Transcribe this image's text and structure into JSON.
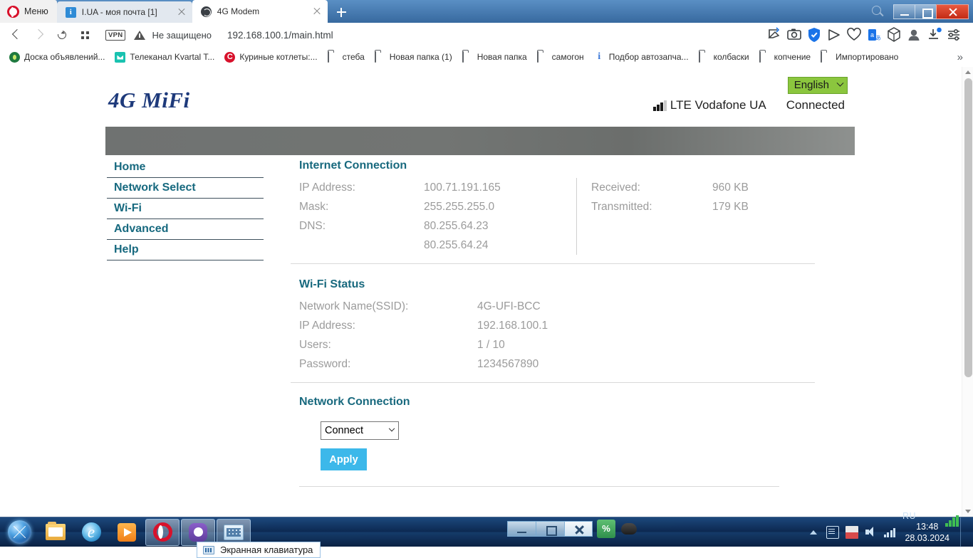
{
  "browser": {
    "opera_menu_label": "Меню",
    "tabs": [
      {
        "title": "I.UA - моя почта [1]",
        "favicon": "mail-icon",
        "active": false
      },
      {
        "title": "4G Modem",
        "favicon": "globe-icon",
        "active": true
      }
    ],
    "new_tab_label": "+",
    "window_controls": {
      "minimize": "minimize-icon",
      "maximize": "maximize-icon",
      "close": "close-icon"
    },
    "address_bar": {
      "vpn_badge": "VPN",
      "security_label": "Не защищено",
      "url": "192.168.100.1/main.html"
    },
    "toolbar_icons": [
      "snapshot-icon",
      "camera-icon",
      "shield-check-icon",
      "send-icon",
      "heart-icon",
      "translate-icon",
      "cube-icon",
      "profile-icon",
      "downloads-icon",
      "easy-setup-icon"
    ],
    "bookmarks": [
      {
        "label": "Доска объявлений...",
        "icon": "doska-icon"
      },
      {
        "label": "Телеканал Kvartal T...",
        "icon": "kvartal-icon"
      },
      {
        "label": "Куриные котлеты:...",
        "icon": "kotlety-icon"
      },
      {
        "label": "стеба",
        "icon": "folder-icon"
      },
      {
        "label": "Новая папка (1)",
        "icon": "folder-icon"
      },
      {
        "label": "Новая папка",
        "icon": "folder-icon"
      },
      {
        "label": "самогон",
        "icon": "folder-icon"
      },
      {
        "label": "Подбор автозапча...",
        "icon": "info-icon"
      },
      {
        "label": "колбаски",
        "icon": "folder-icon"
      },
      {
        "label": "копчение",
        "icon": "folder-icon"
      },
      {
        "label": "Импортировано",
        "icon": "folder-icon"
      }
    ],
    "bookmarks_overflow": "»"
  },
  "page": {
    "logo": "4G MiFi",
    "language": {
      "value": "English"
    },
    "status": {
      "signal_bars_filled": 3,
      "signal_bars_total": 4,
      "carrier": "LTE Vodafone  UA",
      "connection": "Connected"
    },
    "nav": [
      {
        "label": "Home"
      },
      {
        "label": "Network Select"
      },
      {
        "label": "Wi-Fi"
      },
      {
        "label": "Advanced"
      },
      {
        "label": "Help"
      }
    ],
    "internet_connection": {
      "title": "Internet Connection",
      "left": [
        {
          "key": "IP Address:",
          "value": "100.71.191.165"
        },
        {
          "key": "Mask:",
          "value": "255.255.255.0"
        },
        {
          "key": "DNS:",
          "value": "80.255.64.23"
        },
        {
          "key": "",
          "value": "80.255.64.24"
        }
      ],
      "right": [
        {
          "key": "Received:",
          "value": "960 KB"
        },
        {
          "key": "Transmitted:",
          "value": "179 KB"
        }
      ]
    },
    "wifi_status": {
      "title": "Wi-Fi Status",
      "rows": [
        {
          "key": "Network Name(SSID):",
          "value": "4G-UFI-BCC"
        },
        {
          "key": "IP Address:",
          "value": "192.168.100.1"
        },
        {
          "key": "Users:",
          "value": "1 / 10"
        },
        {
          "key": "Password:",
          "value": "1234567890"
        }
      ]
    },
    "network_connection": {
      "title": "Network Connection",
      "select_value": "Connect",
      "apply_label": "Apply"
    },
    "colors": {
      "heading": "#18697e",
      "nav_link": "#17697f",
      "logo": "#1e3a7b",
      "language_bg": "#8bc63e",
      "apply_bg": "#3cb8ea",
      "value_text": "#9b9b9b"
    }
  },
  "taskbar": {
    "start_label": "start-orb",
    "pinned": [
      {
        "name": "explorer-icon"
      },
      {
        "name": "internet-explorer-icon"
      },
      {
        "name": "media-player-icon"
      }
    ],
    "running": [
      {
        "name": "opera-icon"
      },
      {
        "name": "viber-icon"
      },
      {
        "name": "onscreen-keyboard-icon"
      }
    ],
    "tooltip": "Экранная клавиатура",
    "language_indicator": "RU",
    "tray_icons": [
      "action-center-icon",
      "flag-icon",
      "volume-icon",
      "signal-icon"
    ],
    "clock": {
      "time": "13:48",
      "date": "28.03.2024"
    }
  }
}
